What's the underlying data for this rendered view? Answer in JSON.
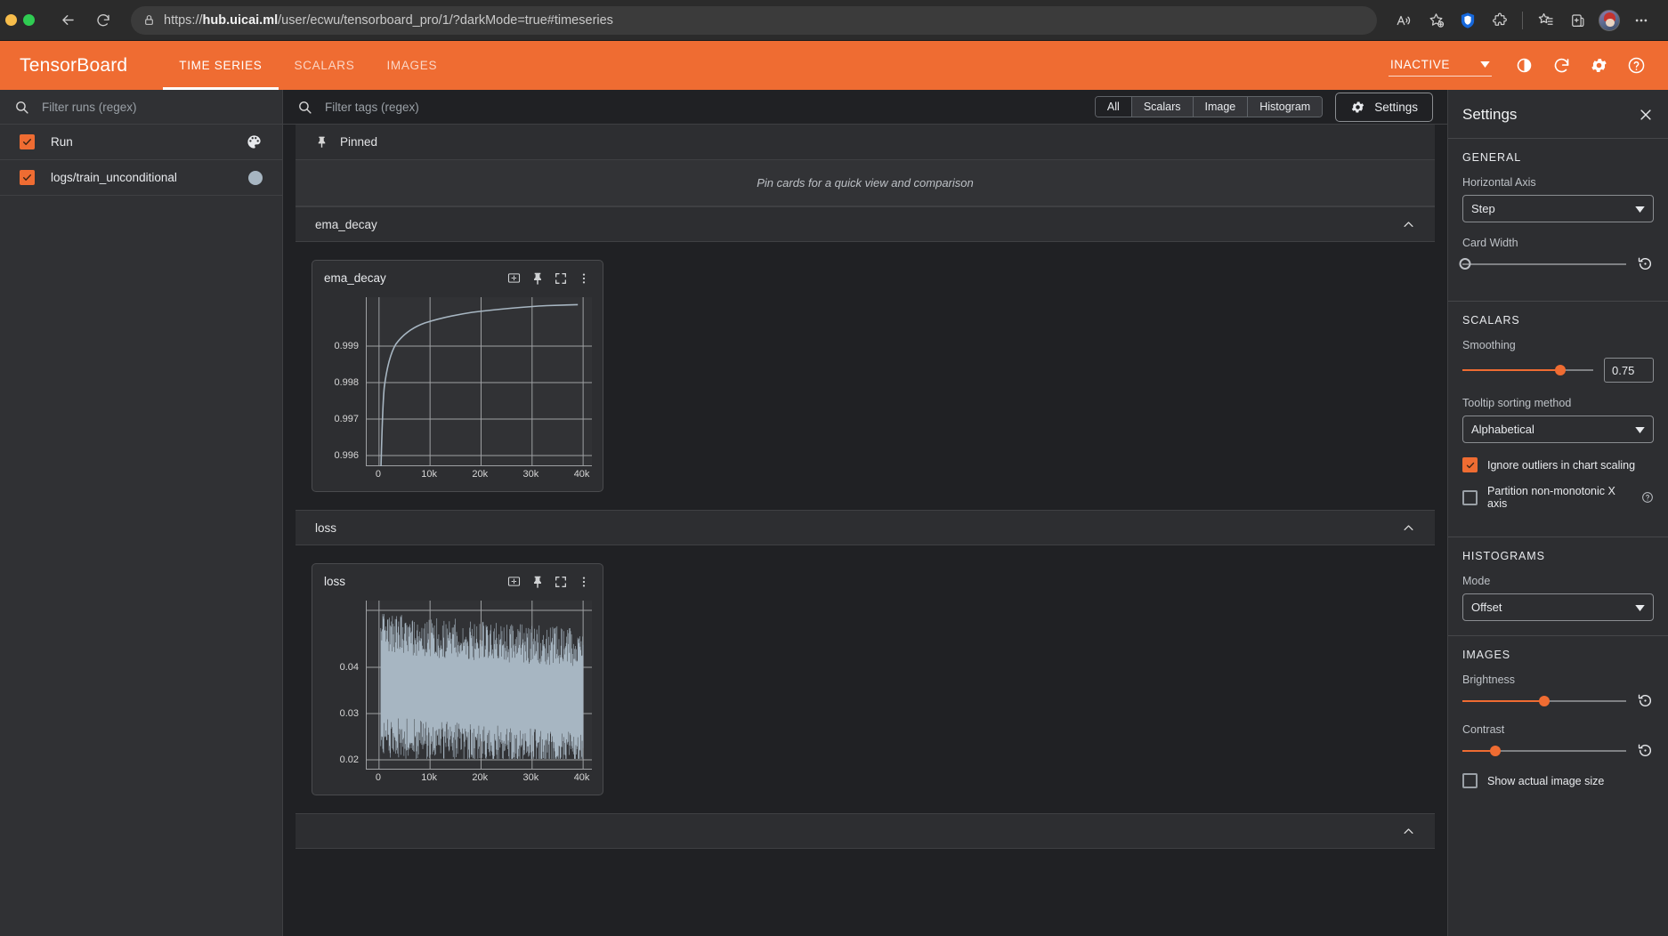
{
  "browser": {
    "url_prefix": "https://",
    "url_host": "hub.uicai.ml",
    "url_path": "/user/ecwu/tensorboard_pro/1/?darkMode=true#timeseries",
    "icons": {
      "back": "back-arrow-icon",
      "reload": "reload-icon",
      "lock": "lock-icon",
      "read_aloud": "read-aloud-icon",
      "favorite": "add-favorite-icon",
      "shield": "shield-extension-icon",
      "extensions": "extensions-puzzle-icon",
      "collections": "collections-icon",
      "split": "split-screen-icon",
      "profile": "profile-avatar",
      "more": "more-options-icon"
    }
  },
  "header": {
    "logo": "TensorBoard",
    "tabs": [
      {
        "label": "TIME SERIES",
        "active": true
      },
      {
        "label": "SCALARS",
        "active": false
      },
      {
        "label": "IMAGES",
        "active": false
      }
    ],
    "reload_status": "INACTIVE",
    "icons": {
      "dark_mode": "brightness-icon",
      "refresh": "refresh-icon",
      "settings": "gear-icon",
      "help": "help-circle-icon"
    }
  },
  "runs_pane": {
    "filter_placeholder": "Filter runs (regex)",
    "filter_value": "",
    "header_row": {
      "label": "Run",
      "checked": true
    },
    "items": [
      {
        "label": "logs/train_unconditional",
        "checked": true,
        "color": "#a7b6c2"
      }
    ]
  },
  "toolbar": {
    "tag_filter_placeholder": "Filter tags (regex)",
    "tag_filter_value": "",
    "plugin_filters": [
      {
        "label": "All",
        "selected": true
      },
      {
        "label": "Scalars",
        "selected": false
      },
      {
        "label": "Image",
        "selected": false
      },
      {
        "label": "Histogram",
        "selected": false
      }
    ],
    "settings_label": "Settings"
  },
  "pinned": {
    "label": "Pinned",
    "empty_message": "Pin cards for a quick view and comparison"
  },
  "groups": [
    {
      "name": "ema_decay",
      "expanded": true
    },
    {
      "name": "loss",
      "expanded": true
    }
  ],
  "cards": [
    {
      "title": "ema_decay"
    },
    {
      "title": "loss"
    }
  ],
  "card_actions": {
    "fit_label": "fit-domain-icon",
    "pin_label": "pin-icon",
    "fullscreen_label": "fullscreen-icon",
    "menu_label": "more-vertical-icon"
  },
  "settings": {
    "title": "Settings",
    "general": {
      "section": "GENERAL",
      "horizontal_axis_label": "Horizontal Axis",
      "horizontal_axis_value": "Step",
      "card_width_label": "Card Width",
      "card_width_percent": 0
    },
    "scalars": {
      "section": "SCALARS",
      "smoothing_label": "Smoothing",
      "smoothing_value": "0.75",
      "smoothing_percent": 75,
      "tooltip_sort_label": "Tooltip sorting method",
      "tooltip_sort_value": "Alphabetical",
      "ignore_outliers_label": "Ignore outliers in chart scaling",
      "ignore_outliers_checked": true,
      "partition_label": "Partition non-monotonic X axis",
      "partition_checked": false
    },
    "histograms": {
      "section": "HISTOGRAMS",
      "mode_label": "Mode",
      "mode_value": "Offset"
    },
    "images": {
      "section": "IMAGES",
      "brightness_label": "Brightness",
      "brightness_percent": 50,
      "contrast_label": "Contrast",
      "contrast_percent": 20,
      "actual_size_label": "Show actual image size",
      "actual_size_checked": false
    }
  },
  "chart_data": [
    {
      "type": "line",
      "title": "ema_decay",
      "xlabel": "",
      "ylabel": "",
      "xtick_labels": [
        "0",
        "10k",
        "20k",
        "30k",
        "40k"
      ],
      "xticks": [
        0,
        10000,
        20000,
        30000,
        40000
      ],
      "ytick_labels": [
        "0.996",
        "0.997",
        "0.998",
        "0.999"
      ],
      "yticks": [
        0.996,
        0.997,
        0.998,
        0.999
      ],
      "xlim": [
        -1500,
        45000
      ],
      "ylim": [
        0.9955,
        0.99955
      ],
      "grid": true,
      "legend": "none",
      "series": [
        {
          "name": "logs/train_unconditional",
          "color": "#a7b6c2",
          "x": [
            300,
            600,
            900,
            1200,
            1600,
            2000,
            2600,
            3200,
            4000,
            5000,
            6200,
            7600,
            9000,
            11000,
            13000,
            15000,
            18000,
            21000,
            25000,
            29000,
            33000,
            37000,
            41000,
            43500
          ],
          "y": [
            0.9958,
            0.99625,
            0.99685,
            0.99735,
            0.99785,
            0.99818,
            0.99852,
            0.99872,
            0.9989,
            0.99904,
            0.99915,
            0.99923,
            0.99928,
            0.99933,
            0.99936,
            0.99938,
            0.99941,
            0.99943,
            0.99945,
            0.99946,
            0.99947,
            0.99948,
            0.99948,
            0.99949
          ]
        }
      ]
    },
    {
      "type": "line",
      "title": "loss",
      "xlabel": "",
      "ylabel": "",
      "xtick_labels": [
        "0",
        "10k",
        "20k",
        "30k",
        "40k"
      ],
      "xticks": [
        0,
        10000,
        20000,
        30000,
        40000
      ],
      "ytick_labels": [
        "0.02",
        "0.03",
        "0.04"
      ],
      "yticks": [
        0.02,
        0.03,
        0.04
      ],
      "xlim": [
        0,
        45000
      ],
      "ylim": [
        0.013,
        0.052
      ],
      "grid": true,
      "legend": "none",
      "note": "dense high-frequency noisy trace, band roughly 0.015-0.050, slight downward drift",
      "series": [
        {
          "name": "logs/train_unconditional",
          "color": "#a7b6c2",
          "band_low": 0.0155,
          "band_high": 0.0495,
          "mean": 0.032
        }
      ]
    }
  ]
}
